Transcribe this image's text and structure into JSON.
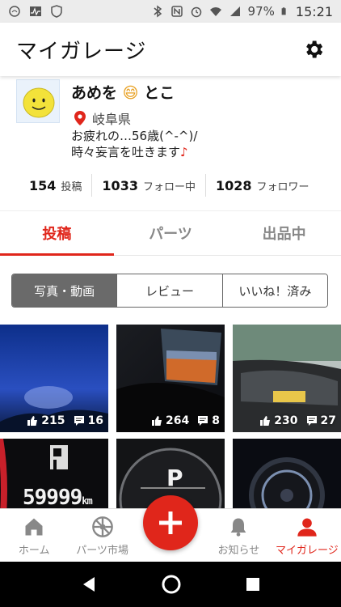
{
  "status_bar": {
    "battery": "97%",
    "time": "15:21"
  },
  "app_bar": {
    "title": "マイガレージ",
    "settings_icon": "gear-icon"
  },
  "profile": {
    "name": "あめを",
    "name_emoji": "😄",
    "name_suffix": "とこ",
    "location": "岐阜県",
    "bio_line1": "お疲れの…56歳(^-^)/",
    "bio_line2": "時々妄言を吐きます",
    "bio_note": "♪"
  },
  "stats": [
    {
      "num": "154",
      "label": "投稿"
    },
    {
      "num": "1033",
      "label": "フォロー中"
    },
    {
      "num": "1028",
      "label": "フォロワー"
    }
  ],
  "tabs": [
    {
      "label": "投稿",
      "active": true
    },
    {
      "label": "パーツ",
      "active": false
    },
    {
      "label": "出品中",
      "active": false
    }
  ],
  "segments": [
    {
      "label": "写真・動画",
      "active": true
    },
    {
      "label": "レビュー",
      "active": false
    },
    {
      "label": "いいね！済み",
      "active": false
    }
  ],
  "posts": [
    {
      "likes": "215",
      "comments": "16"
    },
    {
      "likes": "264",
      "comments": "8"
    },
    {
      "likes": "230",
      "comments": "27"
    },
    {
      "text": "59999",
      "unit": "km"
    },
    {
      "text": "P"
    },
    {}
  ],
  "bottom_nav": [
    {
      "label": "ホーム",
      "icon": "home-icon",
      "active": false
    },
    {
      "label": "パーツ市場",
      "icon": "wheel-icon",
      "active": false
    },
    {
      "label": "",
      "icon": "plus-icon",
      "active": false
    },
    {
      "label": "お知らせ",
      "icon": "bell-icon",
      "active": false
    },
    {
      "label": "マイガレージ",
      "icon": "person-icon",
      "active": true
    }
  ],
  "colors": {
    "accent": "#e0261b",
    "segment_active": "#6a6a6a"
  }
}
